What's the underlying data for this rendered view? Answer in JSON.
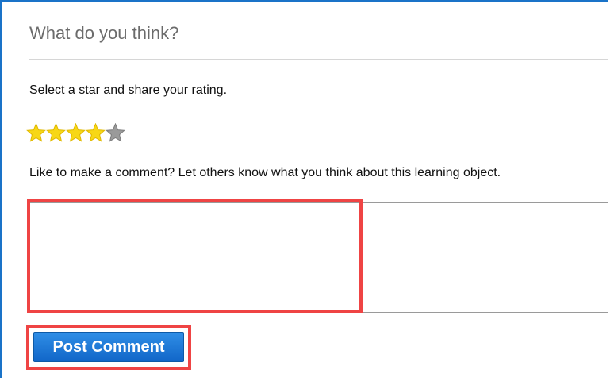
{
  "heading": "What do you think?",
  "rating": {
    "prompt": "Select a star and share your rating.",
    "value": 4,
    "max": 5,
    "filled_color": "#f7d716",
    "empty_color": "#9a9a9a"
  },
  "comment": {
    "prompt": "Like to make a comment? Let others know what you think about this learning object.",
    "value": ""
  },
  "post_button_label": "Post Comment",
  "colors": {
    "frame_border": "#1a73c8",
    "highlight": "#ef4444",
    "button_blue": "#1a73d6"
  }
}
